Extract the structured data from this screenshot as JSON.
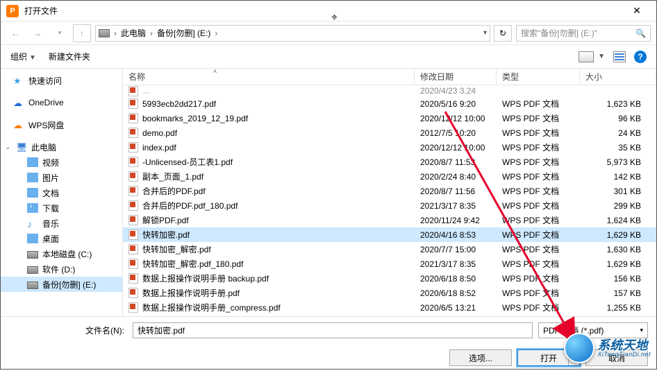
{
  "title": "打开文件",
  "breadcrumb": {
    "root": "此电脑",
    "folder": "备份[勿删] (E:)"
  },
  "search": {
    "placeholder": "搜索\"备份[勿删] (E:)\""
  },
  "toolbar": {
    "org": "组织",
    "newfolder": "新建文件夹"
  },
  "sidebar": {
    "quick": "快速访问",
    "onedrive": "OneDrive",
    "wps": "WPS网盘",
    "pc": "此电脑",
    "children": {
      "video": "视频",
      "pic": "图片",
      "doc": "文档",
      "download": "下载",
      "music": "音乐",
      "desktop": "桌面",
      "c": "本地磁盘 (C:)",
      "d": "软件 (D:)",
      "e": "备份[勿删] (E:)"
    }
  },
  "columns": {
    "name": "名称",
    "mod": "修改日期",
    "type": "类型",
    "size": "大小"
  },
  "files": [
    {
      "name": "5993ecb2dd217.pdf",
      "mod": "2020/5/16 9:20",
      "type": "WPS PDF 文档",
      "size": "1,623 KB",
      "sel": false
    },
    {
      "name": "bookmarks_2019_12_19.pdf",
      "mod": "2020/12/12 10:00",
      "type": "WPS PDF 文档",
      "size": "96 KB",
      "sel": false
    },
    {
      "name": "demo.pdf",
      "mod": "2012/7/5 10:20",
      "type": "WPS PDF 文档",
      "size": "24 KB",
      "sel": false
    },
    {
      "name": "index.pdf",
      "mod": "2020/12/12 10:00",
      "type": "WPS PDF 文档",
      "size": "35 KB",
      "sel": false
    },
    {
      "name": "-Unlicensed-员工表1.pdf",
      "mod": "2020/8/7 11:53",
      "type": "WPS PDF 文档",
      "size": "5,973 KB",
      "sel": false
    },
    {
      "name": "副本_页面_1.pdf",
      "mod": "2020/2/24 8:40",
      "type": "WPS PDF 文档",
      "size": "142 KB",
      "sel": false
    },
    {
      "name": "合并后的PDF.pdf",
      "mod": "2020/8/7 11:56",
      "type": "WPS PDF 文档",
      "size": "301 KB",
      "sel": false
    },
    {
      "name": "合并后的PDF.pdf_180.pdf",
      "mod": "2021/3/17 8:35",
      "type": "WPS PDF 文档",
      "size": "299 KB",
      "sel": false
    },
    {
      "name": "解锁PDF.pdf",
      "mod": "2020/11/24 9:42",
      "type": "WPS PDF 文档",
      "size": "1,624 KB",
      "sel": false
    },
    {
      "name": "快转加密.pdf",
      "mod": "2020/4/16 8:53",
      "type": "WPS PDF 文档",
      "size": "1,629 KB",
      "sel": true
    },
    {
      "name": "快转加密_解密.pdf",
      "mod": "2020/7/7 15:00",
      "type": "WPS PDF 文档",
      "size": "1,630 KB",
      "sel": false
    },
    {
      "name": "快转加密_解密.pdf_180.pdf",
      "mod": "2021/3/17 8:35",
      "type": "WPS PDF 文档",
      "size": "1,629 KB",
      "sel": false
    },
    {
      "name": "数据上报操作说明手册 backup.pdf",
      "mod": "2020/6/18 8:50",
      "type": "WPS PDF 文档",
      "size": "156 KB",
      "sel": false
    },
    {
      "name": "数据上报操作说明手册.pdf",
      "mod": "2020/6/18 8:52",
      "type": "WPS PDF 文档",
      "size": "157 KB",
      "sel": false
    },
    {
      "name": "数据上报操作说明手册_compress.pdf",
      "mod": "2020/6/5 13:21",
      "type": "WPS PDF 文档",
      "size": "1,255 KB",
      "sel": false
    }
  ],
  "truncated_row": {
    "mod": "2020/4/23 3.24"
  },
  "filename": {
    "label": "文件名(N):",
    "value": "快转加密.pdf",
    "filter": "PDF 文档 (*.pdf)"
  },
  "buttons": {
    "options": "选项...",
    "open": "打开",
    "cancel": "取消"
  },
  "watermark": {
    "line1": "系统天地",
    "line2": "XiTongTianDi.net"
  }
}
